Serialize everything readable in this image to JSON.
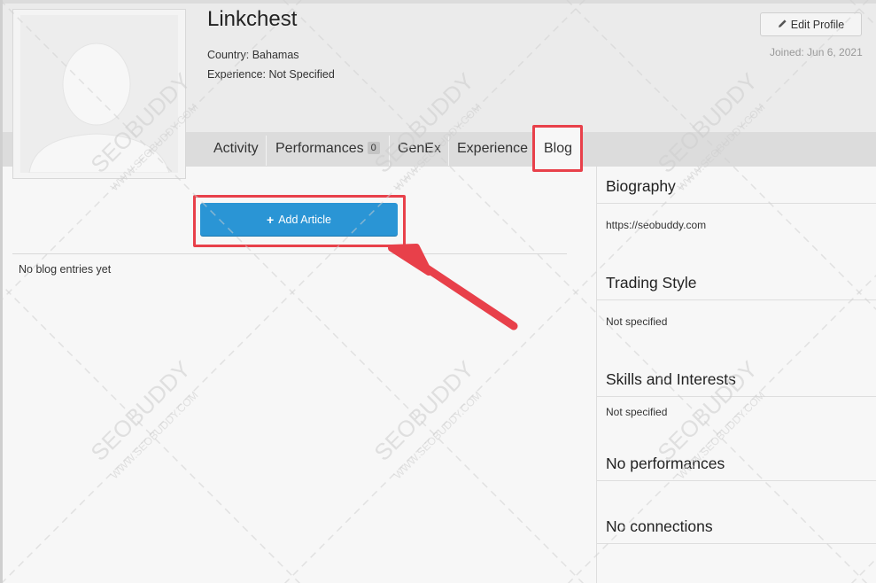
{
  "profile": {
    "username": "Linkchest",
    "country": "Country: Bahamas",
    "experience": "Experience: Not Specified",
    "edit_label": "Edit Profile",
    "joined": "Joined: Jun 6, 2021",
    "edit_icon": "pencil-icon"
  },
  "tabs": [
    {
      "label": "Activity"
    },
    {
      "label": "Performances",
      "badge": "0"
    },
    {
      "label": "GenEx"
    },
    {
      "label": "Experience"
    },
    {
      "label": "Blog",
      "active": true
    }
  ],
  "blog": {
    "add_label": "Add Article",
    "add_icon": "plus-icon",
    "empty_text": "No blog entries yet"
  },
  "sidebar": {
    "biography_title": "Biography",
    "biography_text": "https://seobuddy.com",
    "trading_title": "Trading Style",
    "trading_text": "Not specified",
    "skills_title": "Skills and Interests",
    "skills_text": "Not specified",
    "performances_title": "No performances",
    "connections_title": "No connections"
  },
  "watermark": {
    "brand": "SEOBUDDY",
    "site": "WWW.SEOBUDDY.COM"
  },
  "colors": {
    "accent": "#2a95d5",
    "highlight": "#e8404a"
  }
}
